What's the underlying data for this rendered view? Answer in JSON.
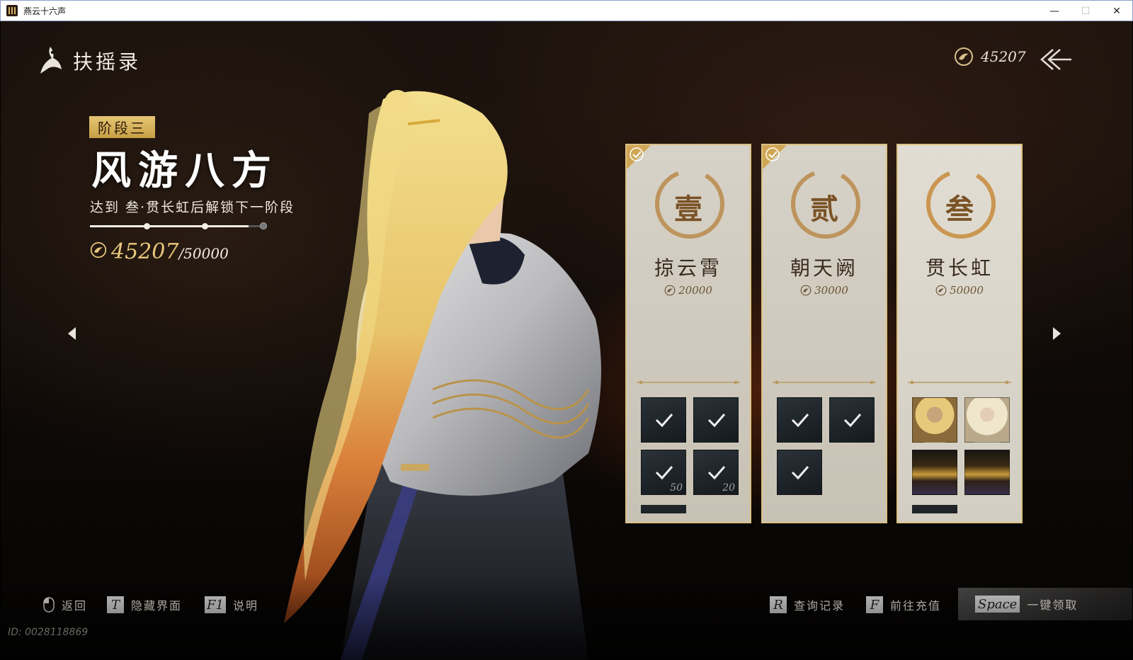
{
  "window": {
    "title": "燕云十六声",
    "minimize": "—",
    "maximize": "☐",
    "close": "✕"
  },
  "header": {
    "title": "扶摇录",
    "currency": "45207"
  },
  "stage": {
    "badge": "阶段三",
    "name": "风游八方",
    "desc": "达到 叁·贯长虹后解锁下一阶段",
    "progress_current": "45207",
    "progress_max": "/50000",
    "progress_fraction": 0.904
  },
  "cards": [
    {
      "numeral": "壹",
      "name": "掠云霄",
      "cost": "20000",
      "claimed": true
    },
    {
      "numeral": "贰",
      "name": "朝天阙",
      "cost": "30000",
      "claimed": true
    },
    {
      "numeral": "叁",
      "name": "贯长虹",
      "cost": "50000",
      "claimed": false
    }
  ],
  "card1_items": {
    "qty_a": "50",
    "qty_b": "20"
  },
  "bottom": {
    "back_label": "返回",
    "hide_key": "T",
    "hide_label": "隐藏界面",
    "help_key": "F1",
    "help_label": "说明",
    "record_key": "R",
    "record_label": "查询记录",
    "recharge_key": "F",
    "recharge_label": "前往充值",
    "claim_key": "Space",
    "claim_label": "一键领取"
  },
  "player_id": "ID: 0028118869",
  "colors": {
    "gold": "#e9c97d",
    "card_border": "#debe78",
    "badge": "#d9b45f"
  }
}
